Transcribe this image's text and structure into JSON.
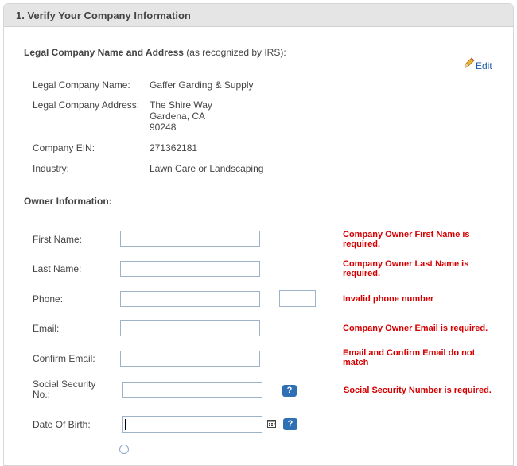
{
  "panel": {
    "title": "1. Verify Your Company Information"
  },
  "legal": {
    "heading": "Legal Company Name and Address",
    "note": "(as recognized by IRS):",
    "edit_label": "Edit",
    "rows": {
      "name_label": "Legal Company Name:",
      "name_value": "Gaffer Garding & Supply",
      "address_label": "Legal Company Address:",
      "address_line1": "The Shire Way",
      "address_line2": "Gardena, CA",
      "address_line3": "90248",
      "ein_label": "Company EIN:",
      "ein_value": "271362181",
      "industry_label": "Industry:",
      "industry_value": "Lawn Care or Landscaping"
    }
  },
  "owner": {
    "heading": "Owner Information:",
    "first_name": {
      "label": "First Name:",
      "value": "",
      "error": "Company Owner First Name is required."
    },
    "last_name": {
      "label": "Last Name:",
      "value": "",
      "error": "Company Owner Last Name is required."
    },
    "phone": {
      "label": "Phone:",
      "value": "",
      "ext": "",
      "error": "Invalid phone number"
    },
    "email": {
      "label": "Email:",
      "value": "",
      "error": "Company Owner Email is required."
    },
    "confirm_email": {
      "label": "Confirm Email:",
      "value": "",
      "error": "Email and Confirm Email do not match"
    },
    "ssn": {
      "label_line1": "Social Security",
      "label_line2": "No.:",
      "value": "",
      "help": "?",
      "error": "Social Security Number is required."
    },
    "dob": {
      "label": "Date Of Birth:",
      "value": "",
      "help": "?"
    }
  },
  "colors": {
    "error": "#d40000",
    "link": "#1a5ba8",
    "help_bg": "#2f6fb3",
    "header_bg": "#e5e5e5"
  }
}
